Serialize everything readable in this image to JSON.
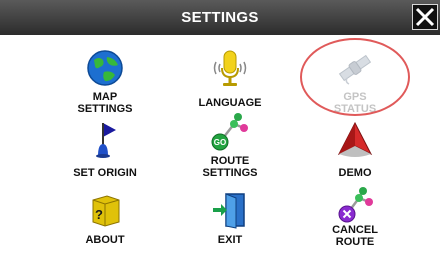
{
  "header": {
    "title": "SETTINGS",
    "close_icon": "close-x-icon"
  },
  "colors": {
    "title_bar": "#3a3a3a",
    "title_text": "#ffffff",
    "highlight_ring": "#e05a5a",
    "disabled_text": "#c4c4c4"
  },
  "menu": {
    "map_settings": {
      "label": "MAP\nSETTINGS",
      "icon": "globe-icon"
    },
    "language": {
      "label": "LANGUAGE",
      "icon": "microphone-icon"
    },
    "gps_status": {
      "label": "GPS\nSTATUS",
      "icon": "satellite-icon",
      "state": "disabled"
    },
    "set_origin": {
      "label": "SET ORIGIN",
      "icon": "flag-icon"
    },
    "route_settings": {
      "label": "ROUTE\nSETTINGS",
      "icon": "route-nodes-icon"
    },
    "demo": {
      "label": "DEMO",
      "icon": "demo-arrow-icon"
    },
    "about": {
      "label": "ABOUT",
      "icon": "question-block-icon"
    },
    "exit": {
      "label": "EXIT",
      "icon": "exit-door-icon"
    },
    "cancel_route": {
      "label": "CANCEL\nROUTE",
      "icon": "cancel-route-icon"
    }
  }
}
